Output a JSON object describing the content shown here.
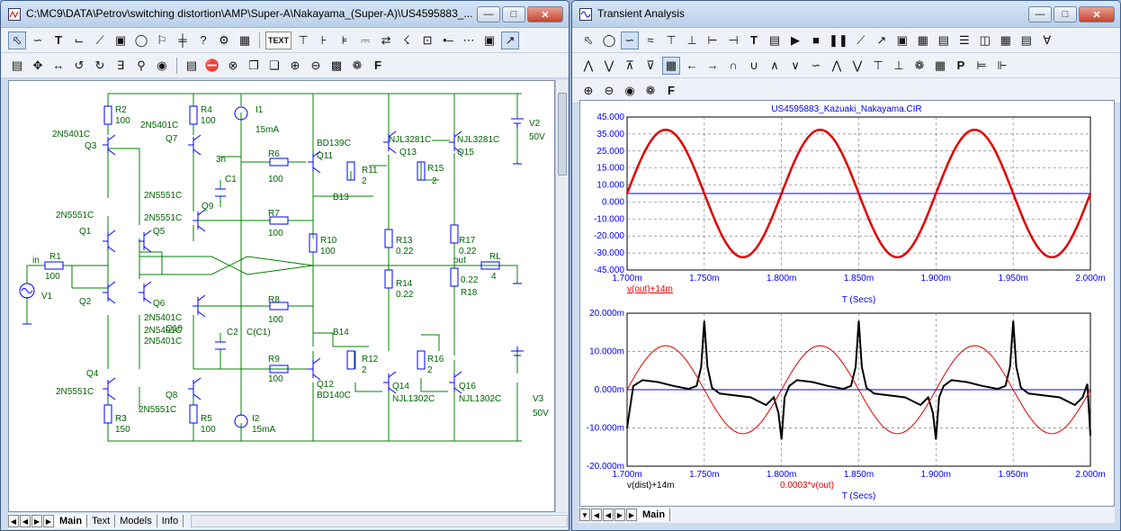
{
  "schematic_window": {
    "title": "C:\\MC9\\DATA\\Petrov\\switching distortion\\AMP\\Super-A\\Nakayama_(Super-A)\\US4595883_...",
    "tabs": [
      "Main",
      "Text",
      "Models",
      "Info"
    ],
    "active_tab": "Main",
    "toolbar_text_button": "TEXT",
    "labels": [
      {
        "text": "R2",
        "bind": "r2"
      },
      {
        "text": "100"
      },
      {
        "text": "R4"
      },
      {
        "text": "100"
      },
      {
        "text": "I1"
      },
      {
        "text": "15mA"
      },
      {
        "text": "2N5401C"
      },
      {
        "text": "Q3"
      },
      {
        "text": "2N5401C"
      },
      {
        "text": "Q7"
      },
      {
        "text": "3n"
      },
      {
        "text": "C1"
      },
      {
        "text": "R6"
      },
      {
        "text": "100"
      },
      {
        "text": "BD139C"
      },
      {
        "text": "Q11"
      },
      {
        "text": "NJL3281C"
      },
      {
        "text": "Q13"
      },
      {
        "text": "NJL3281C"
      },
      {
        "text": "Q15"
      },
      {
        "text": "R11"
      },
      {
        "text": "2"
      },
      {
        "text": "R15"
      },
      {
        "text": "2"
      },
      {
        "text": "V2"
      },
      {
        "text": "50V"
      },
      {
        "text": "B13"
      },
      {
        "text": "2N5551C"
      },
      {
        "text": "Q9"
      },
      {
        "text": "2N5551C"
      },
      {
        "text": "2N5551C"
      },
      {
        "text": "R7"
      },
      {
        "text": "100"
      },
      {
        "text": "Q1"
      },
      {
        "text": "Q5"
      },
      {
        "text": "R10"
      },
      {
        "text": "100"
      },
      {
        "text": "R13"
      },
      {
        "text": "0.22"
      },
      {
        "text": "R17"
      },
      {
        "text": "0.22"
      },
      {
        "text": "in"
      },
      {
        "text": "R1"
      },
      {
        "text": "100"
      },
      {
        "text": "out"
      },
      {
        "text": "RL"
      },
      {
        "text": "4"
      },
      {
        "text": "V1"
      },
      {
        "text": "R14"
      },
      {
        "text": "0.22"
      },
      {
        "text": "0.22"
      },
      {
        "text": "R18"
      },
      {
        "text": "Q2"
      },
      {
        "text": "Q6"
      },
      {
        "text": "2N5401C"
      },
      {
        "text": "R8"
      },
      {
        "text": "100"
      },
      {
        "text": "2N5401C"
      },
      {
        "text": "Q10"
      },
      {
        "text": "2N5401C"
      },
      {
        "text": "C2"
      },
      {
        "text": "C(C1)"
      },
      {
        "text": "B14"
      },
      {
        "text": "R12"
      },
      {
        "text": "2"
      },
      {
        "text": "R16"
      },
      {
        "text": "2"
      },
      {
        "text": "Q4"
      },
      {
        "text": "R9"
      },
      {
        "text": "100"
      },
      {
        "text": "Q12"
      },
      {
        "text": "BD140C"
      },
      {
        "text": "Q14"
      },
      {
        "text": "NJL1302C"
      },
      {
        "text": "Q16"
      },
      {
        "text": "NJL1302C"
      },
      {
        "text": "V3"
      },
      {
        "text": "50V"
      },
      {
        "text": "2N5551C"
      },
      {
        "text": "Q8"
      },
      {
        "text": "2N5551C"
      },
      {
        "text": "R3"
      },
      {
        "text": "150"
      },
      {
        "text": "R5"
      },
      {
        "text": "100"
      },
      {
        "text": "I2"
      },
      {
        "text": "15mA"
      }
    ]
  },
  "transient_window": {
    "title": "Transient Analysis",
    "tabs": [
      "Main"
    ],
    "active_tab": "Main",
    "plot_title": "US4595883_Kazuaki_Nakayama.CIR",
    "font_button": "F"
  },
  "colors": {
    "wire": "#008000",
    "component": "#0000ff",
    "label": "#006400",
    "trace_red": "#e00000",
    "trace_black": "#000000",
    "axis_blue": "#0000ff",
    "grid": "#808080"
  },
  "chart_data": [
    {
      "type": "line",
      "title": "US4595883_Kazuaki_Nakayama.CIR",
      "xlabel": "T (Secs)",
      "ylabel": "",
      "xlim": [
        0.0017,
        0.002
      ],
      "ylim": [
        -45,
        45
      ],
      "x_tick_labels": [
        "1.700m",
        "1.750m",
        "1.800m",
        "1.850m",
        "1.900m",
        "1.950m",
        "2.000m"
      ],
      "y_tick_labels": [
        "45.000",
        "35.000",
        "25.000",
        "15.000",
        "10.000",
        "0.000",
        "-10.000",
        "-20.000",
        "-30.000",
        "-45.000"
      ],
      "grid": true,
      "series": [
        {
          "name": "v(out)+14m",
          "color": "#e00000",
          "shape": "sine",
          "amplitude": 37.5,
          "period": 0.0001,
          "phase_x0": 0.0017
        }
      ]
    },
    {
      "type": "line",
      "title": "",
      "xlabel": "T (Secs)",
      "ylabel": "",
      "xlim": [
        0.0017,
        0.002
      ],
      "ylim": [
        -0.02,
        0.02
      ],
      "x_tick_labels": [
        "1.700m",
        "1.750m",
        "1.800m",
        "1.850m",
        "1.900m",
        "1.950m",
        "2.000m"
      ],
      "y_tick_labels": [
        "20.000m",
        "10.000m",
        "0.000m",
        "-10.000m",
        "-20.000m"
      ],
      "grid": true,
      "series": [
        {
          "name": "v(dist)+14m",
          "color": "#000000",
          "x": [
            0.0017,
            0.001704,
            0.00171,
            0.00172,
            0.00173,
            0.00174,
            0.001745,
            0.001748,
            0.00175,
            0.001752,
            0.001755,
            0.00176,
            0.00177,
            0.00178,
            0.00179,
            0.001795,
            0.001798,
            0.0018,
            0.001802,
            0.001805,
            0.00181,
            0.00182,
            0.00183,
            0.00184,
            0.001845,
            0.001848,
            0.00185,
            0.001852,
            0.001855,
            0.00186,
            0.00187,
            0.00188,
            0.00189,
            0.001895,
            0.001898,
            0.0019,
            0.001902,
            0.001905,
            0.00191,
            0.00192,
            0.00193,
            0.00194,
            0.001945,
            0.001948,
            0.00195,
            0.001952,
            0.001955,
            0.00196,
            0.00197,
            0.00198,
            0.00199,
            0.001995,
            0.001998,
            0.002
          ],
          "y": [
            -0.01,
            0.001,
            0.0025,
            0.002,
            0.001,
            0.0002,
            0.001,
            0.006,
            0.018,
            0.006,
            0.0005,
            -0.001,
            -0.0015,
            -0.002,
            -0.004,
            -0.002,
            -0.006,
            -0.013,
            -0.002,
            0.001,
            0.0025,
            0.002,
            0.001,
            0.0002,
            0.001,
            0.006,
            0.018,
            0.006,
            0.0005,
            -0.001,
            -0.0015,
            -0.002,
            -0.004,
            -0.002,
            -0.006,
            -0.013,
            -0.002,
            0.001,
            0.0025,
            0.002,
            0.001,
            0.0002,
            0.001,
            0.006,
            0.018,
            0.006,
            0.0005,
            -0.001,
            -0.0015,
            -0.002,
            -0.004,
            -0.002,
            0.0015,
            -0.012
          ]
        },
        {
          "name": "0.0003*v(out)",
          "color": "#e00000",
          "shape": "sine",
          "amplitude": 0.0115,
          "period": 0.0001,
          "phase_x0": 0.0017
        }
      ]
    }
  ]
}
